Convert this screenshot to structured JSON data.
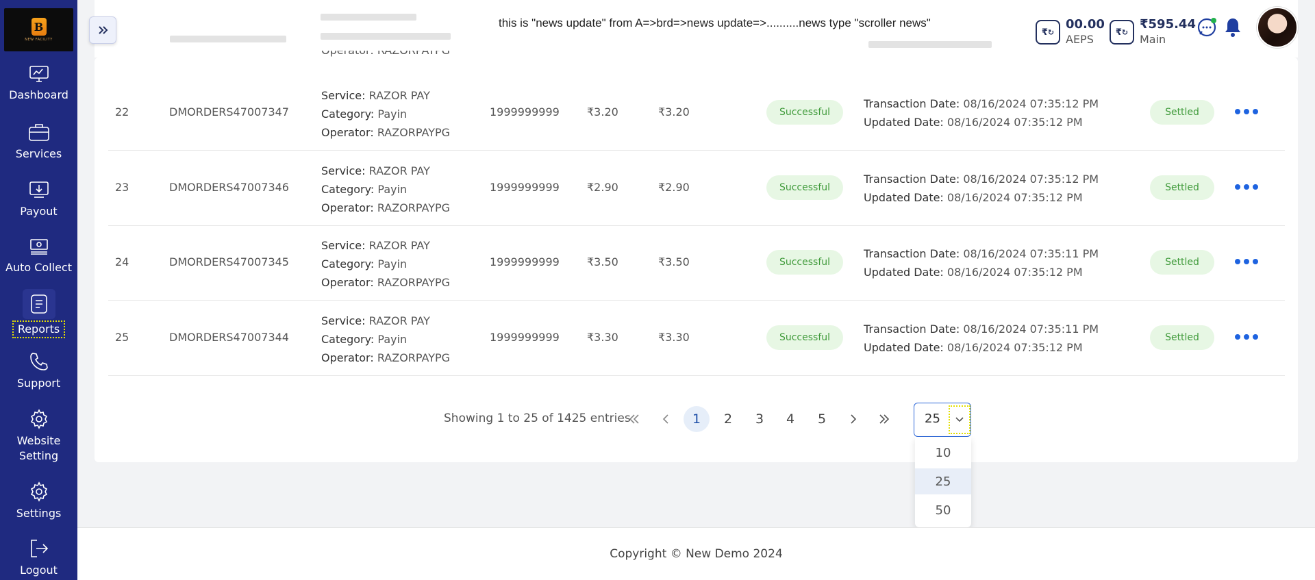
{
  "sidebar": {
    "logo_text": "B",
    "logo_tag": "NEW FACILITY",
    "items": [
      {
        "label": "Dashboard",
        "icon": "monitor-icon"
      },
      {
        "label": "Services",
        "icon": "briefcase-icon"
      },
      {
        "label": "Payout",
        "icon": "payout-icon"
      },
      {
        "label": "Auto Collect",
        "icon": "cash-icon"
      },
      {
        "label": "Reports",
        "icon": "report-icon",
        "active": true
      },
      {
        "label": "Support",
        "icon": "phone-icon"
      },
      {
        "label": "Website Setting",
        "icon": "gear-icon"
      },
      {
        "label": "Settings",
        "icon": "gear-icon"
      },
      {
        "label": "Logout",
        "icon": "logout-icon"
      }
    ]
  },
  "topbar": {
    "news": "this is \"news update\" from A=>brd=>news update=>..........news type \"scroller news\"",
    "wallets": [
      {
        "amount": "00.00",
        "label": "AEPS",
        "symbol": "₹"
      },
      {
        "amount": "₹595.44",
        "label": "Main",
        "symbol": "₹"
      }
    ]
  },
  "rows": [
    {
      "sn": "22",
      "order_id": "DMORDERS47007347",
      "service": "RAZOR PAY",
      "category": "Payin",
      "operator": "RAZORPAYPG",
      "mobile": "1999999999",
      "amount": "₹3.20",
      "net": "₹3.20",
      "status": "Successful",
      "txn_date": "08/16/2024 07:35:12 PM",
      "upd_date": "08/16/2024 07:35:12 PM",
      "settlement": "Settled"
    },
    {
      "sn": "23",
      "order_id": "DMORDERS47007346",
      "service": "RAZOR PAY",
      "category": "Payin",
      "operator": "RAZORPAYPG",
      "mobile": "1999999999",
      "amount": "₹2.90",
      "net": "₹2.90",
      "status": "Successful",
      "txn_date": "08/16/2024 07:35:12 PM",
      "upd_date": "08/16/2024 07:35:12 PM",
      "settlement": "Settled"
    },
    {
      "sn": "24",
      "order_id": "DMORDERS47007345",
      "service": "RAZOR PAY",
      "category": "Payin",
      "operator": "RAZORPAYPG",
      "mobile": "1999999999",
      "amount": "₹3.50",
      "net": "₹3.50",
      "status": "Successful",
      "txn_date": "08/16/2024 07:35:11 PM",
      "upd_date": "08/16/2024 07:35:12 PM",
      "settlement": "Settled"
    },
    {
      "sn": "25",
      "order_id": "DMORDERS47007344",
      "service": "RAZOR PAY",
      "category": "Payin",
      "operator": "RAZORPAYPG",
      "mobile": "1999999999",
      "amount": "₹3.30",
      "net": "₹3.30",
      "status": "Successful",
      "txn_date": "08/16/2024 07:35:11 PM",
      "upd_date": "08/16/2024 07:35:12 PM",
      "settlement": "Settled"
    }
  ],
  "labels": {
    "service": "Service:",
    "category": "Category:",
    "operator": "Operator:",
    "txn_date": "Transaction Date:",
    "upd_date": "Updated Date:",
    "partial_operator": "Operator: RAZORPAYPG"
  },
  "pagination": {
    "showing": "Showing 1 to 25 of 1425 entries",
    "first": "«",
    "prev": "‹",
    "pages": [
      "1",
      "2",
      "3",
      "4",
      "5"
    ],
    "next": "›",
    "last": "»",
    "page_size": "25",
    "options": [
      "10",
      "25",
      "50"
    ]
  },
  "footer": {
    "copyright": "Copyright © New Demo 2024"
  },
  "colors": {
    "sidebar": "#1f2a80",
    "accent": "#1e63e0",
    "success_bg": "#e7f7e4",
    "success_text": "#3f9a3a"
  }
}
